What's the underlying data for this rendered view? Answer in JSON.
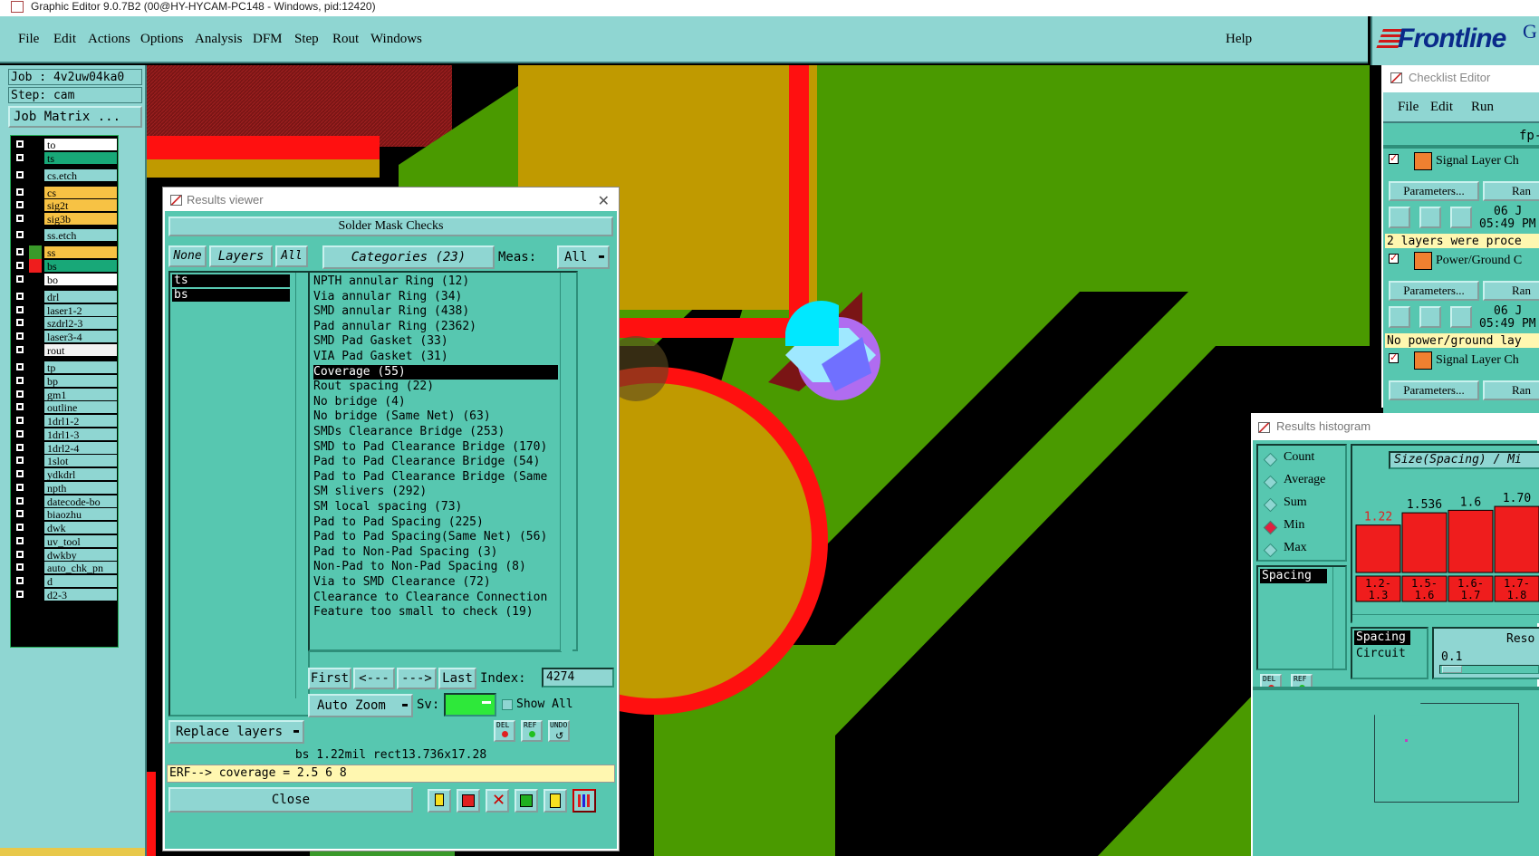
{
  "window": {
    "title": "Graphic Editor 9.0.7B2 (00@HY-HYCAM-PC148 - Windows, pid:12420)"
  },
  "menu": {
    "items": [
      "File",
      "Edit",
      "Actions",
      "Options",
      "Analysis",
      "DFM",
      "Step",
      "Rout",
      "Windows"
    ],
    "help": "Help"
  },
  "brand": {
    "logo_text": "Frontline",
    "logo_suffix": "G"
  },
  "job": {
    "label": "Job : 4v2uw04ka0",
    "step": "Step: cam",
    "matrix_button": "Job Matrix ..."
  },
  "layers": [
    {
      "name": "to",
      "color": "#ffffff",
      "sw": "#000000"
    },
    {
      "name": "ts",
      "color": "#18a878",
      "sw": "#000000"
    },
    {
      "name": "cs.etch",
      "color": "#8fd6d2",
      "sw": "#000000"
    },
    {
      "name": "cs",
      "color": "#f7c244",
      "sw": "#000000"
    },
    {
      "name": "sig2t",
      "color": "#f7c244",
      "sw": "#000000"
    },
    {
      "name": "sig3b",
      "color": "#f7c244",
      "sw": "#000000"
    },
    {
      "name": "ss.etch",
      "color": "#8fd6d2",
      "sw": "#000000"
    },
    {
      "name": "ss",
      "color": "#f7c244",
      "sw": "#3a9a2a"
    },
    {
      "name": "bs",
      "color": "#18a878",
      "sw": "#ef1d1d"
    },
    {
      "name": "bo",
      "color": "#ffffff",
      "sw": "#000000"
    },
    {
      "name": "drl",
      "color": "#8fd6d2",
      "sw": "#000000"
    },
    {
      "name": "laser1-2",
      "color": "#8fd6d2",
      "sw": "#000000"
    },
    {
      "name": "szdrl2-3",
      "color": "#8fd6d2",
      "sw": "#000000"
    },
    {
      "name": "laser3-4",
      "color": "#8fd6d2",
      "sw": "#000000"
    },
    {
      "name": "rout",
      "color": "#f2f2f2",
      "sw": "#000000"
    },
    {
      "name": "tp",
      "color": "#8fd6d2",
      "sw": "#000000"
    },
    {
      "name": "bp",
      "color": "#8fd6d2",
      "sw": "#000000"
    },
    {
      "name": "gm1",
      "color": "#8fd6d2",
      "sw": "#000000"
    },
    {
      "name": "outline",
      "color": "#8fd6d2",
      "sw": "#000000"
    },
    {
      "name": "1drl1-2",
      "color": "#8fd6d2",
      "sw": "#000000"
    },
    {
      "name": "1drl1-3",
      "color": "#8fd6d2",
      "sw": "#000000"
    },
    {
      "name": "1drl2-4",
      "color": "#8fd6d2",
      "sw": "#000000"
    },
    {
      "name": "1slot",
      "color": "#8fd6d2",
      "sw": "#000000"
    },
    {
      "name": "ydkdrl",
      "color": "#8fd6d2",
      "sw": "#000000"
    },
    {
      "name": "npth",
      "color": "#8fd6d2",
      "sw": "#000000"
    },
    {
      "name": "datecode-bo",
      "color": "#8fd6d2",
      "sw": "#000000"
    },
    {
      "name": "biaozhu",
      "color": "#8fd6d2",
      "sw": "#000000"
    },
    {
      "name": "dwk",
      "color": "#8fd6d2",
      "sw": "#000000"
    },
    {
      "name": "uv_tool",
      "color": "#8fd6d2",
      "sw": "#000000"
    },
    {
      "name": "dwkby",
      "color": "#8fd6d2",
      "sw": "#000000"
    },
    {
      "name": "auto_chk_pn",
      "color": "#8fd6d2",
      "sw": "#000000"
    },
    {
      "name": "d",
      "color": "#8fd6d2",
      "sw": "#000000"
    },
    {
      "name": "d2-3",
      "color": "#8fd6d2",
      "sw": "#000000"
    }
  ],
  "results_viewer": {
    "title": "Results viewer",
    "check_name": "Solder Mask Checks",
    "btn_none": "None",
    "btn_layers": "Layers",
    "btn_all": "All",
    "categories_label": "Categories (23)",
    "meas_label": "Meas:",
    "meas_value": "All",
    "layer_items": [
      "ts",
      "bs"
    ],
    "categories": [
      "NPTH annular Ring (12)",
      "Via annular Ring (34)",
      "SMD annular Ring (438)",
      "Pad annular Ring (2362)",
      "SMD Pad Gasket (33)",
      "VIA Pad Gasket (31)",
      "Coverage (55)",
      "Rout spacing (22)",
      "No bridge (4)",
      "No bridge (Same Net) (63)",
      "SMDs Clearance Bridge (253)",
      "SMD to Pad Clearance Bridge (170)",
      "Pad to Pad Clearance Bridge (54)",
      "Pad to Pad Clearance Bridge (Same",
      "SM slivers (292)",
      "SM local spacing (73)",
      "Pad to Pad Spacing (225)",
      "Pad to Pad Spacing(Same Net) (56)",
      "Pad to Non-Pad Spacing (3)",
      "Non-Pad to Non-Pad Spacing (8)",
      "Via to SMD Clearance (72)",
      "Clearance to Clearance Connection",
      "Feature too small to check (19)"
    ],
    "selected_category_index": 6,
    "nav": {
      "first": "First",
      "prev": "<---",
      "next": "--->",
      "last": "Last",
      "index_label": "Index:",
      "index_value": "4274"
    },
    "auto_zoom": "Auto Zoom",
    "sv_label": "Sv:",
    "show_all": "Show All",
    "del": "DEL",
    "ref": "REF",
    "undo": "UNDO",
    "replace_layers": "Replace layers",
    "status": "bs 1.22mil   rect13.736x17.28",
    "erf": "ERF--> coverage = 2.5 6 8",
    "close": "Close"
  },
  "checklist_editor": {
    "title": "Checklist Editor",
    "menu": [
      "File",
      "Edit",
      "Run"
    ],
    "fp_label": "fp-",
    "checks": [
      {
        "name": "Signal Layer Ch",
        "params": "Parameters...",
        "ran": "Ran",
        "date": "06 J",
        "time": "05:49 PM",
        "msg": "2 layers were proce"
      },
      {
        "name": "Power/Ground C",
        "params": "Parameters...",
        "ran": "Ran",
        "date": "06 J",
        "time": "05:49 PM",
        "msg": "No power/ground lay"
      },
      {
        "name": "Signal Layer Ch",
        "params": "Parameters...",
        "ran": "Ran"
      }
    ]
  },
  "histogram": {
    "title": "Results histogram",
    "options": [
      "Count",
      "Average",
      "Sum",
      "Min",
      "Max"
    ],
    "selected_option": "Min",
    "axis_label": "Size(Spacing) / Mi",
    "left_list": [
      "Spacing"
    ],
    "bottom_list": [
      "Spacing",
      "Circuit"
    ],
    "reso_label": "Reso",
    "reso_value": "0.1",
    "del": "DEL",
    "ref": "REF",
    "bars": [
      {
        "value": 1.22,
        "label": "1.22",
        "range": [
          "1.2-",
          "1.3"
        ]
      },
      {
        "value": 1.536,
        "label": "1.536",
        "range": [
          "1.5-",
          "1.6"
        ]
      },
      {
        "value": 1.6,
        "label": "1.6",
        "range": [
          "1.6-",
          "1.7"
        ]
      },
      {
        "value": 1.7,
        "label": "1.70",
        "range": [
          "1.7-",
          "1.8"
        ]
      }
    ]
  },
  "colors": {
    "teal": "#8fd6d2",
    "dark_teal": "#57c7b0",
    "board_green": "#4a9a00",
    "pad_gold": "#c09a00",
    "mask_red": "#ff1010"
  }
}
